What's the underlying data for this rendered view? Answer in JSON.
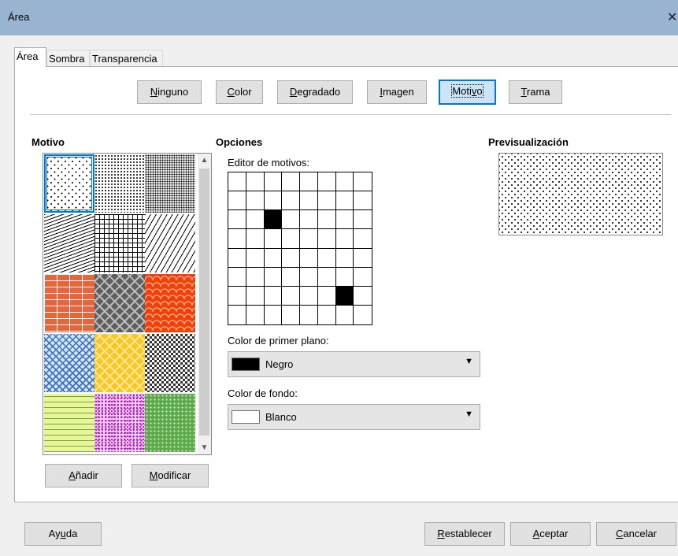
{
  "window": {
    "title": "Área",
    "close_glyph": "✕"
  },
  "tabs": [
    {
      "label": "Área",
      "active": true
    },
    {
      "label": "Sombra",
      "active": false
    },
    {
      "label": "Transparencia",
      "active": false
    }
  ],
  "fill_types": [
    {
      "label": "Ninguno",
      "mnemonic": "N"
    },
    {
      "label": "Color",
      "mnemonic": "C"
    },
    {
      "label": "Degradado",
      "mnemonic": "D"
    },
    {
      "label": "Imagen",
      "mnemonic": "I"
    },
    {
      "label": "Motivo",
      "mnemonic": "v",
      "active": true
    },
    {
      "label": "Trama",
      "mnemonic": "T"
    }
  ],
  "pattern_section": {
    "heading": "Motivo",
    "patterns": [
      {
        "name": "dots-sparse",
        "colors": [
          "#000000",
          "#ffffff"
        ],
        "selected": true
      },
      {
        "name": "dots-medium",
        "colors": [
          "#000000",
          "#ffffff"
        ]
      },
      {
        "name": "dots-dense",
        "colors": [
          "#000000",
          "#ffffff"
        ]
      },
      {
        "name": "zigzag-lines",
        "colors": [
          "#000000",
          "#ffffff"
        ]
      },
      {
        "name": "small-grid",
        "colors": [
          "#000000",
          "#ffffff"
        ]
      },
      {
        "name": "diagonal-dashes",
        "colors": [
          "#000000",
          "#ffffff"
        ]
      },
      {
        "name": "brick-orange",
        "colors": [
          "#ffffff",
          "#e8643a"
        ]
      },
      {
        "name": "weave-gray",
        "colors": [
          "#bdbdbd",
          "#5f5f5f"
        ]
      },
      {
        "name": "scales-red",
        "colors": [
          "#ffd0b0",
          "#f0410a"
        ]
      },
      {
        "name": "waves-blue",
        "colors": [
          "#3f6fbf",
          "#d2e6f8"
        ]
      },
      {
        "name": "weave-yellow",
        "colors": [
          "#ffe98a",
          "#f8c52a"
        ]
      },
      {
        "name": "checker-gray",
        "colors": [
          "#333333",
          "#cccccc"
        ]
      },
      {
        "name": "dashes-lime",
        "colors": [
          "#7f9f3a",
          "#e6f79a"
        ]
      },
      {
        "name": "speckle-magenta",
        "colors": [
          "#b020c0",
          "#f6d8f6"
        ]
      },
      {
        "name": "speckle-green",
        "colors": [
          "#d8f0d0",
          "#5caa4c"
        ]
      }
    ],
    "add_label": "Añadir",
    "add_mnemonic": "A",
    "modify_label": "Modificar",
    "modify_mnemonic": "M"
  },
  "options": {
    "heading": "Opciones",
    "editor_label": "Editor de motivos:",
    "grid_size": 8,
    "grid_on_cells": [
      [
        2,
        2
      ],
      [
        6,
        6
      ]
    ],
    "foreground_label": "Color de primer plano:",
    "foreground_value": "Negro",
    "foreground_color": "#000000",
    "background_label": "Color de fondo:",
    "background_value": "Blanco",
    "background_color": "#ffffff"
  },
  "preview": {
    "heading": "Previsualización"
  },
  "footer": {
    "help_label": "Ayuda",
    "help_mnemonic": "u",
    "reset_label": "Restablecer",
    "reset_mnemonic": "R",
    "ok_label": "Aceptar",
    "ok_mnemonic": "A",
    "cancel_label": "Cancelar",
    "cancel_mnemonic": "C"
  }
}
